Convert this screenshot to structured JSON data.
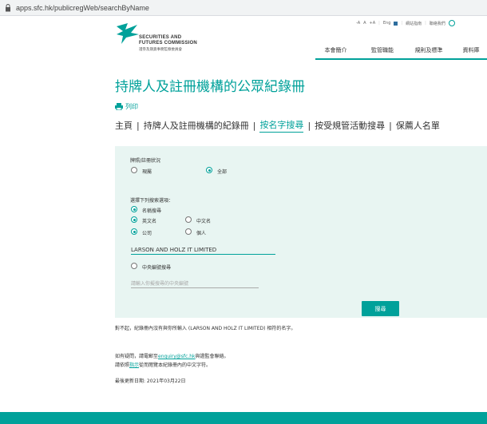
{
  "browser": {
    "url": "apps.sfc.hk/publicregWeb/searchByName"
  },
  "header": {
    "logo_line1": "SECURITIES AND",
    "logo_line2": "FUTURES COMMISSION",
    "logo_line3": "證券及期貨事務監察委員會",
    "toplinks": [
      "-A",
      "A",
      "+A",
      "Eng",
      "網站指南",
      "聯絡我們"
    ],
    "nav": [
      "本會簡介",
      "監管職能",
      "規則及標準",
      "資料庫"
    ]
  },
  "page": {
    "title": "持牌人及註冊機構的公眾紀錄冊",
    "print_label": "列印",
    "tabs": [
      "主頁",
      "持牌人及註冊機構的紀錄冊",
      "按名字搜尋",
      "按受規管活動搜尋",
      "保薦人名單"
    ],
    "active_tab": "按名字搜尋"
  },
  "search": {
    "status_label": "牌照/註冊狀況",
    "status_options": [
      "現屬",
      "全部"
    ],
    "status_selected": "全部",
    "choose_label": "選擇下列搜索選項：",
    "by_name_label": "名稱搜尋",
    "lang_options": [
      "英文名",
      "中文名"
    ],
    "lang_selected": "英文名",
    "type_options": [
      "公司",
      "個人"
    ],
    "type_selected": "公司",
    "name_value": "LARSON AND HOLZ IT LIMITED",
    "ce_label": "中央編號搜尋",
    "ce_placeholder": "請輸入你擬搜尋的中央編號",
    "search_button": "搜尋"
  },
  "notice": "對不起，紀錄冊內沒有與你所輸入 (LARSON AND HOLZ IT LIMITED) 相符的名字。",
  "enquiry": {
    "line1_before": "如有疑問，請電郵至",
    "email": "enquiry@sfc.hk",
    "line1_after": "與證監會聯絡。",
    "line2_before": "請依照",
    "line2_link": "指示",
    "line2_after": "從而閱覽本紀錄冊內的中文字符。"
  },
  "last_updated": "最後更新日期: 2021年03月22日",
  "colors": {
    "accent": "#00a19a",
    "panel": "#e8f5f2"
  }
}
